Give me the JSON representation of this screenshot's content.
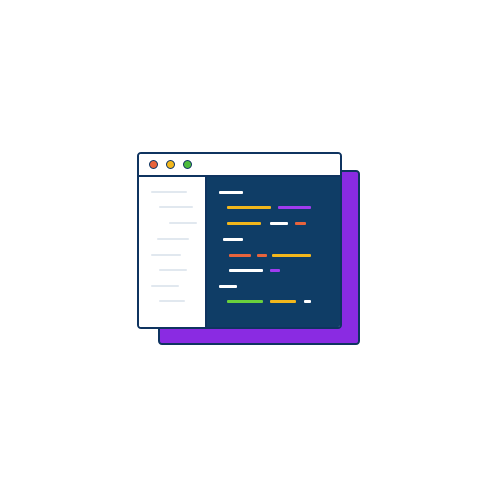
{
  "window": {
    "controls": [
      {
        "name": "close",
        "color": "#e8643c"
      },
      {
        "name": "minimize",
        "color": "#f2b71c"
      },
      {
        "name": "maximize",
        "color": "#4cbb3c"
      }
    ],
    "border_color": "#0f3460",
    "background_color": "#ffffff"
  },
  "backdrop": {
    "color": "#8a2be2"
  },
  "sidebar": {
    "line_color": "#e1e8ef",
    "line_count": 8
  },
  "editor": {
    "background_color": "#0f3d66",
    "palette": {
      "white": "#ffffff",
      "yellow": "#f2b71c",
      "purple": "#a03cf0",
      "orange": "#e8643c",
      "green": "#6ad13c"
    },
    "line_count": 8
  }
}
